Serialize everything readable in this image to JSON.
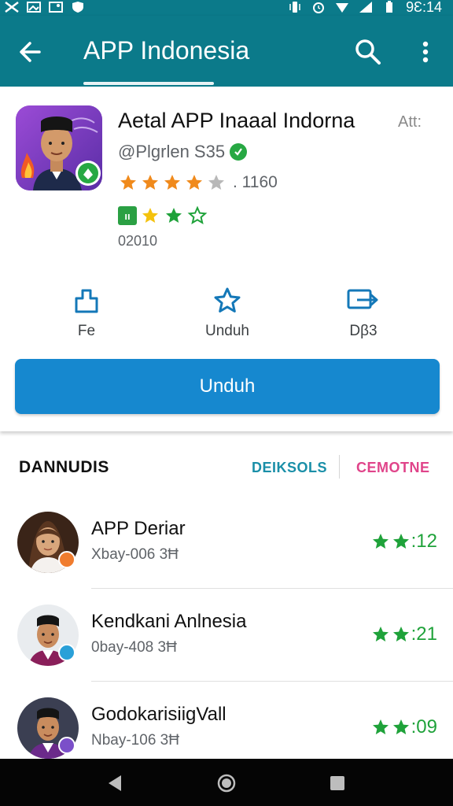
{
  "status_bar": {
    "time": "9Ɛ:14"
  },
  "app_bar": {
    "title": "APP Indonesia"
  },
  "app": {
    "name": "Aetal APP Inaaal Indorna",
    "tag": "Att:",
    "developer": "@Plgrlen S35",
    "rating_count": ". 1160",
    "size": "02010"
  },
  "actions": [
    {
      "label": "Fe",
      "icon": "share-icon"
    },
    {
      "label": "Unduh",
      "icon": "star-icon"
    },
    {
      "label": "Dβ3",
      "icon": "forward-icon"
    }
  ],
  "download_button": "Unduh",
  "section": {
    "title": "DANNUDIS",
    "tab_a": "DEIKSOLS",
    "tab_b": "CEMOTNE"
  },
  "list": [
    {
      "title": "APP Deriar",
      "subtitle": "Xbay-006 3Ħ",
      "rating": ":12",
      "badge_color": "#f07c2e"
    },
    {
      "title": "Kendkani Anlnesia",
      "subtitle": "0bay-408 3Ħ",
      "rating": ":21",
      "badge_color": "#2aa0d8"
    },
    {
      "title": "GodokarisiigVall",
      "subtitle": "Nbay-106 3Ħ",
      "rating": ":09",
      "badge_color": "#7b4fc9"
    }
  ],
  "colors": {
    "primary": "#0b7a8a",
    "button": "#1688cf",
    "rating_green": "#1fa23a",
    "tab_teal": "#1a8fa8",
    "tab_pink": "#e0448a"
  }
}
